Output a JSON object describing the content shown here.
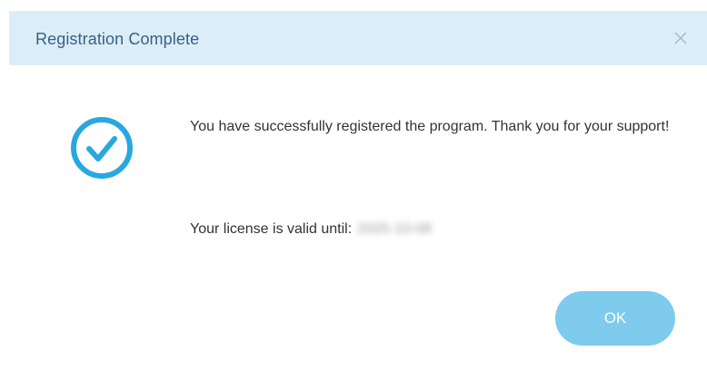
{
  "dialog": {
    "title": "Registration Complete",
    "close_icon": "close-icon",
    "success_icon": "check-circle-icon",
    "message": "You have successfully registered the program. Thank you for your support!",
    "license_label": "Your license is valid until:",
    "license_value": "2025-10-08",
    "ok_label": "OK"
  },
  "colors": {
    "titlebar_bg": "#dbeef8",
    "title_text": "#3a5f85",
    "accent": "#29a8e0",
    "ok_button_bg": "#7ecbee"
  }
}
